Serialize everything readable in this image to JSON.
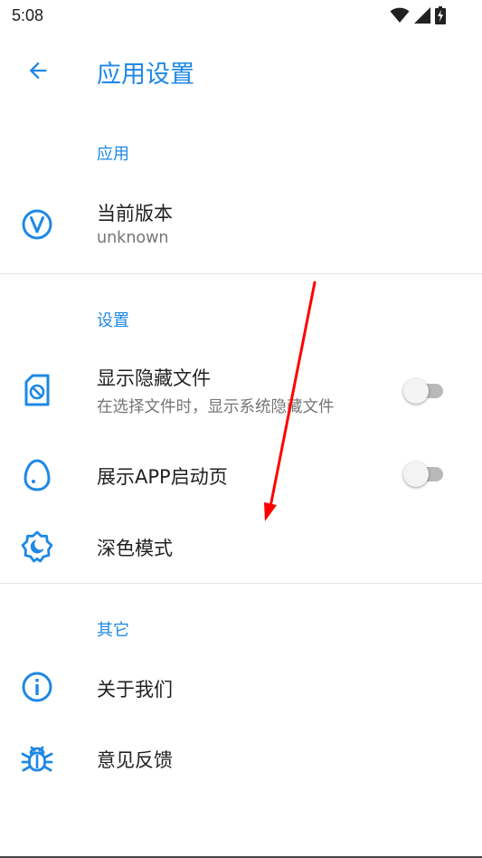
{
  "status_bar": {
    "time": "5:08"
  },
  "app_bar": {
    "title": "应用设置"
  },
  "sections": {
    "app": {
      "header": "应用",
      "version": {
        "title": "当前版本",
        "subtitle": "unknown"
      }
    },
    "settings": {
      "header": "设置",
      "show_hidden": {
        "title": "显示隐藏文件",
        "subtitle": "在选择文件时，显示系统隐藏文件",
        "enabled": false
      },
      "splash": {
        "title": "展示APP启动页",
        "enabled": false
      },
      "dark_mode": {
        "title": "深色模式"
      }
    },
    "other": {
      "header": "其它",
      "about": {
        "title": "关于我们"
      },
      "feedback": {
        "title": "意见反馈"
      }
    }
  },
  "colors": {
    "accent": "#1e88e5",
    "text": "#212121",
    "secondary": "#757575",
    "divider": "#e3e3e3",
    "annotation": "#ff0000"
  },
  "icons": {
    "back": "arrow-left-icon",
    "version": "v-circle-icon",
    "show_hidden": "sd-card-blocked-icon",
    "splash": "egg-icon",
    "dark_mode": "gear-moon-icon",
    "about": "info-circle-icon",
    "feedback": "bug-icon"
  }
}
